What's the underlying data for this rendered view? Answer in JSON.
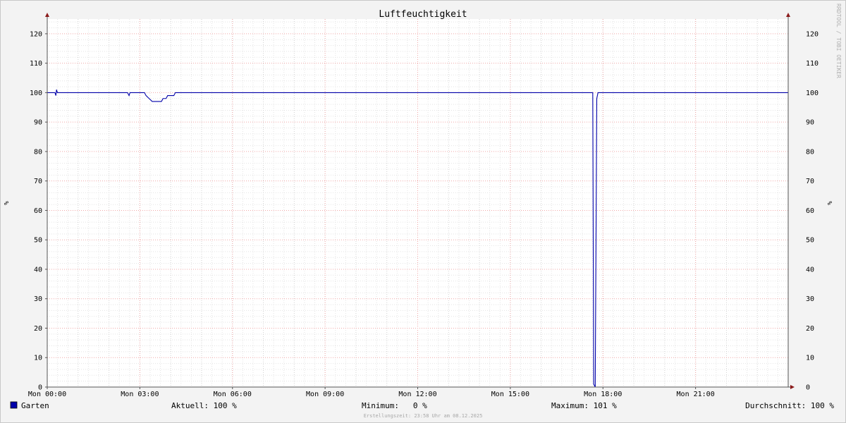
{
  "chart_data": {
    "type": "line",
    "title": "Luftfeuchtigkeit",
    "ylabel": "%",
    "ylim": [
      0,
      125
    ],
    "yticks": [
      0,
      10,
      20,
      30,
      40,
      50,
      60,
      70,
      80,
      90,
      100,
      110,
      120
    ],
    "x_range_hours": [
      0,
      24
    ],
    "xticks": [
      {
        "hour": 0,
        "label": "Mon 00:00"
      },
      {
        "hour": 3,
        "label": "Mon 03:00"
      },
      {
        "hour": 6,
        "label": "Mon 06:00"
      },
      {
        "hour": 9,
        "label": "Mon 09:00"
      },
      {
        "hour": 12,
        "label": "Mon 12:00"
      },
      {
        "hour": 15,
        "label": "Mon 15:00"
      },
      {
        "hour": 18,
        "label": "Mon 18:00"
      },
      {
        "hour": 21,
        "label": "Mon 21:00"
      }
    ],
    "grid": true,
    "side_text": "RRDTOOL / TOBI OETIKER",
    "series": [
      {
        "name": "Garten",
        "color": "#0000aa",
        "points": [
          [
            0.0,
            100
          ],
          [
            0.25,
            100
          ],
          [
            0.28,
            99
          ],
          [
            0.3,
            101
          ],
          [
            0.33,
            100
          ],
          [
            2.6,
            100
          ],
          [
            2.65,
            99
          ],
          [
            2.68,
            100
          ],
          [
            3.15,
            100
          ],
          [
            3.2,
            99
          ],
          [
            3.3,
            98
          ],
          [
            3.4,
            97
          ],
          [
            3.7,
            97
          ],
          [
            3.75,
            98
          ],
          [
            3.85,
            98
          ],
          [
            3.9,
            99
          ],
          [
            4.1,
            99
          ],
          [
            4.15,
            100
          ],
          [
            17.67,
            100
          ],
          [
            17.7,
            1
          ],
          [
            17.75,
            0
          ],
          [
            17.8,
            98
          ],
          [
            17.84,
            100
          ],
          [
            24.0,
            100
          ]
        ]
      }
    ]
  },
  "legend": {
    "series_name": "Garten",
    "series_color": "#0000aa",
    "aktuell": "Aktuell: 100 %",
    "minimum": "Minimum:   0 %",
    "maximum": "Maximum: 101 %",
    "durchschnitt": "Durchschnitt: 100 %"
  },
  "footer": "Erstellungszeit: 23:58 Uhr am 08.12.2025"
}
